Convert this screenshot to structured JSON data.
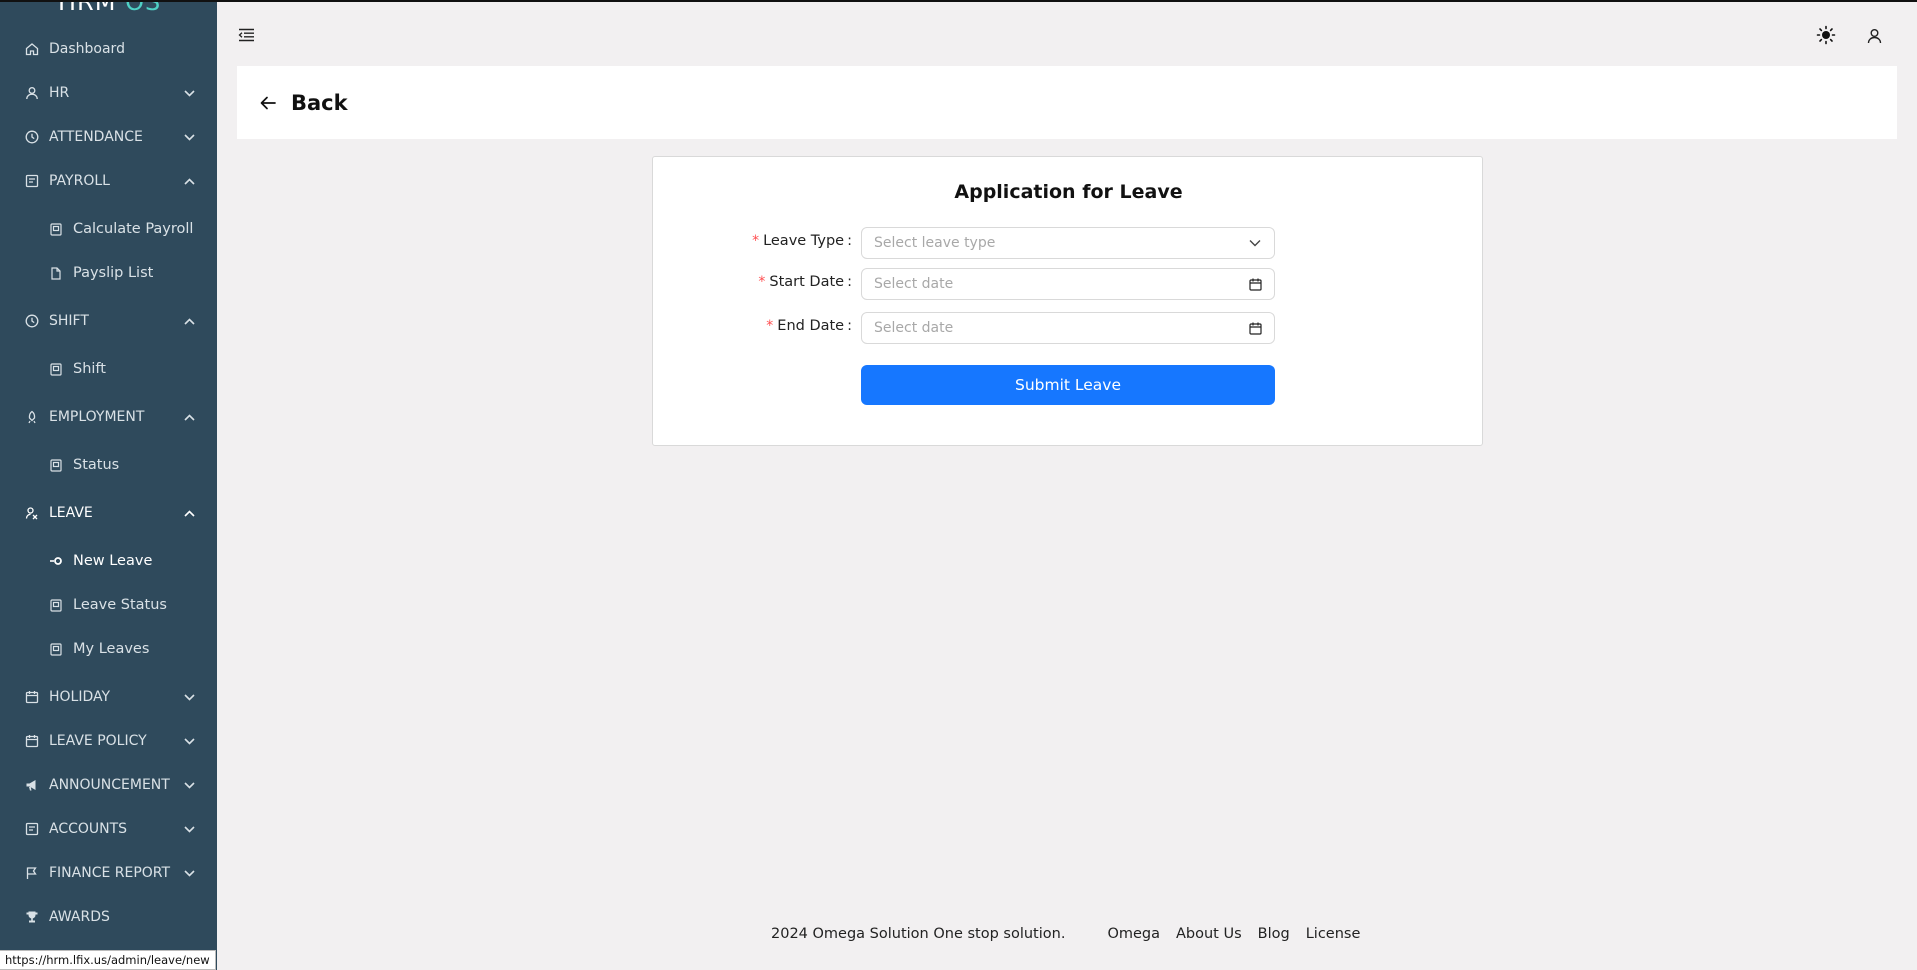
{
  "app": {
    "logo_text": "HRM",
    "logo_accent": "OS"
  },
  "sidebar": {
    "dashboard": "Dashboard",
    "hr": "HR",
    "attendance": "ATTENDANCE",
    "payroll": "PAYROLL",
    "calculate_payroll": "Calculate Payroll",
    "payslip_list": "Payslip List",
    "shift_group": "SHIFT",
    "shift": "Shift",
    "employment": "EMPLOYMENT",
    "status": "Status",
    "leave": "LEAVE",
    "new_leave": "New Leave",
    "leave_status": "Leave Status",
    "my_leaves": "My Leaves",
    "holiday": "HOLIDAY",
    "leave_policy": "LEAVE POLICY",
    "announcement": "ANNOUNCEMENT",
    "accounts": "ACCOUNTS",
    "finance_report": "FINANCE REPORT",
    "awards": "AWARDS"
  },
  "header": {
    "back_label": "Back"
  },
  "form": {
    "title": "Application for Leave",
    "leave_type_label": "Leave Type",
    "leave_type_placeholder": "Select leave type",
    "start_date_label": "Start Date",
    "start_date_placeholder": "Select date",
    "end_date_label": "End Date",
    "end_date_placeholder": "Select date",
    "required_marker": "*",
    "colon": ":",
    "submit_label": "Submit Leave"
  },
  "footer": {
    "copyright": "2024 Omega Solution One stop solution.",
    "links": [
      "Omega",
      "About Us",
      "Blog",
      "License"
    ]
  },
  "status_bar": {
    "url": "https://hrm.lfix.us/admin/leave/new"
  },
  "colors": {
    "sidebar_bg": "#2f4a5c",
    "accent": "#4fd1c5",
    "primary_button": "#1677ff",
    "required": "#ff4d4f",
    "page_bg": "#f2f0f1"
  }
}
